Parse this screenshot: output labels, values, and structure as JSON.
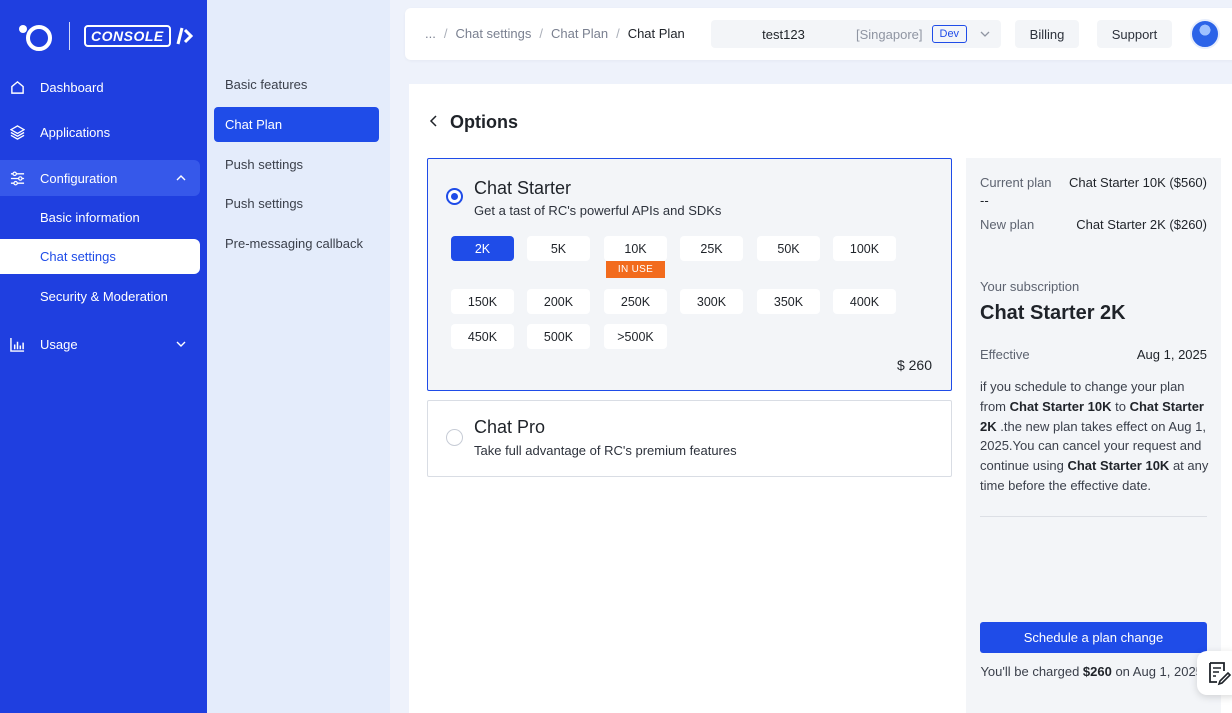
{
  "sidebar": {
    "logo_text": "CONSOLE",
    "items": [
      {
        "label": "Dashboard",
        "icon": "home-icon"
      },
      {
        "label": "Applications",
        "icon": "layers-icon"
      },
      {
        "label": "Configuration",
        "icon": "sliders-icon"
      },
      {
        "label": "Usage",
        "icon": "bar-chart-icon"
      }
    ],
    "config_children": [
      "Basic information",
      "Chat settings",
      "Security & Moderation"
    ]
  },
  "subnav": {
    "items": [
      "Basic features",
      "Chat Plan",
      "Push settings",
      "Push settings",
      "Pre-messaging callback"
    ]
  },
  "header": {
    "breadcrumb": [
      "...",
      "Chat settings",
      "Chat Plan",
      "Chat Plan"
    ],
    "project": {
      "name": "test123",
      "region": "[Singapore]",
      "env": "Dev"
    },
    "billing": "Billing",
    "support": "Support"
  },
  "main": {
    "title": "Options",
    "starter": {
      "name": "Chat Starter",
      "desc": "Get a tast of RC's powerful APIs and SDKs",
      "tiers": [
        "2K",
        "5K",
        "10K",
        "25K",
        "50K",
        "100K",
        "150K",
        "200K",
        "250K",
        "300K",
        "350K",
        "400K",
        "450K",
        "500K",
        ">500K"
      ],
      "selected_tier": "2K",
      "in_use_tier": "10K",
      "in_use_label": "IN USE",
      "price": "$ 260"
    },
    "pro": {
      "name": "Chat Pro",
      "desc": "Take full advantage of RC's premium features"
    }
  },
  "summary": {
    "current_label": "Current plan",
    "current_value": "Chat Starter 10K ($560)",
    "current_extra": "--",
    "new_label": "New plan",
    "new_value": "Chat Starter 2K ($260)",
    "sub_label": "Your subscription",
    "sub_plan": "Chat Starter 2K",
    "effective_label": "Effective",
    "effective_date": "Aug 1, 2025",
    "note": {
      "p1": "if you schedule to change your plan from ",
      "from": "Chat Starter 10K",
      "p2": " to ",
      "to": "Chat Starter 2K",
      "p3": " .the new plan takes effect on Aug 1, 2025.You can cancel your request and continue using ",
      "keep": "Chat Starter 10K",
      "p4": " at any time before the effective date."
    },
    "button": "Schedule a plan change",
    "charged": {
      "p1": "You'll be charged ",
      "amount": "$260",
      "p2": " on Aug 1, 2025."
    }
  },
  "colors": {
    "brand": "#1f3fe0",
    "accent": "#1f4ce8",
    "in_use": "#f26b1d"
  }
}
